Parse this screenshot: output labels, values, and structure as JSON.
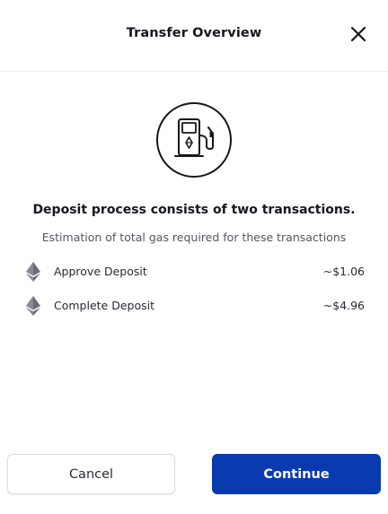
{
  "header": {
    "title": "Transfer Overview",
    "close_icon": "close-icon"
  },
  "hero": {
    "icon": "gas-pump-icon"
  },
  "content": {
    "headline": "Deposit process consists of two transactions.",
    "subline": "Estimation of total gas required for these transactions",
    "rows": [
      {
        "icon": "ethereum-icon",
        "label": "Approve Deposit",
        "amount": "~$1.06"
      },
      {
        "icon": "ethereum-icon",
        "label": "Complete Deposit",
        "amount": "~$4.96"
      }
    ]
  },
  "footer": {
    "cancel_label": "Cancel",
    "continue_label": "Continue"
  },
  "colors": {
    "primary": "#0a3ab0",
    "text": "#16161d",
    "muted": "#55555f",
    "divider": "#eeeef1"
  }
}
